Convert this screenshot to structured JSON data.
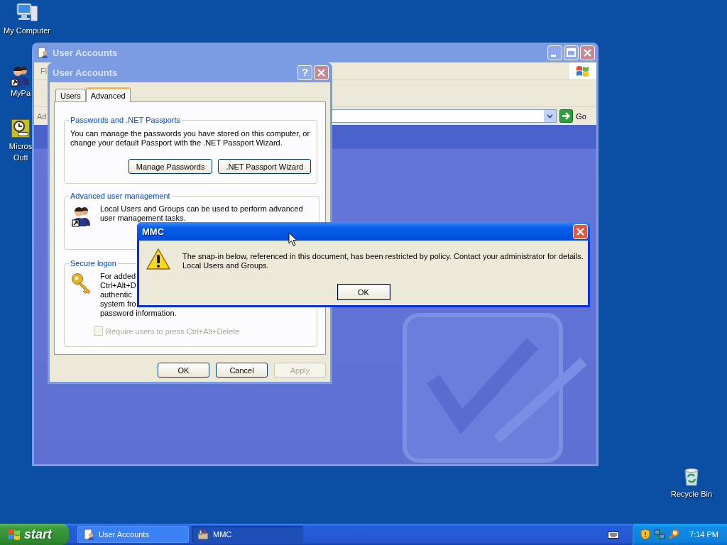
{
  "desktop": {
    "icons": [
      {
        "kind": "computer",
        "lines": [
          "My Computer"
        ]
      },
      {
        "kind": "people",
        "lines": [
          "MyPa"
        ]
      },
      {
        "kind": "clock",
        "lines": [
          "Micros",
          "Outl"
        ]
      },
      {
        "kind": "recycle",
        "lines": [
          "Recycle Bin"
        ]
      }
    ]
  },
  "back_window": {
    "title": "User Accounts",
    "menu": [
      "Fi"
    ],
    "address_label": "Ad",
    "go_label": "Go"
  },
  "dialog": {
    "title": "User Accounts",
    "help": "?",
    "tabs": [
      {
        "label": "Users",
        "selected": false
      },
      {
        "label": "Advanced",
        "selected": true
      }
    ],
    "groups": [
      {
        "kind": "passwords",
        "title": "Passwords and .NET Passports",
        "text": "You can manage the passwords you have stored on this computer, or change your default Passport with the .NET Passport Wizard.",
        "buttons": [
          "Manage Passwords",
          ".NET Passport Wizard"
        ]
      },
      {
        "kind": "management",
        "title": "Advanced user management",
        "text": "Local Users and Groups can be used to perform advanced user management tasks."
      },
      {
        "kind": "logon",
        "title": "Secure logon",
        "lines": [
          "For added",
          "Ctrl+Alt+D",
          "authentic",
          "system fro",
          "password information."
        ],
        "checkbox": {
          "label": "Require users to press Ctrl+Alt+Delete",
          "checked": false,
          "disabled": true
        }
      }
    ],
    "buttons": [
      {
        "label": "OK",
        "disabled": false
      },
      {
        "label": "Cancel",
        "disabled": false
      },
      {
        "label": "Apply",
        "disabled": true
      }
    ]
  },
  "mmc": {
    "title": "MMC",
    "lines": [
      "The snap-in below, referenced in this document, has been restricted by policy. Contact your administrator for details.",
      "Local Users and Groups."
    ],
    "button": "OK"
  },
  "taskbar": {
    "start": "start",
    "tasks": [
      {
        "kind": "accounts",
        "label": "User Accounts",
        "selected": false
      },
      {
        "kind": "console",
        "label": "MMC",
        "selected": true
      }
    ],
    "clock": "7:14 PM"
  }
}
